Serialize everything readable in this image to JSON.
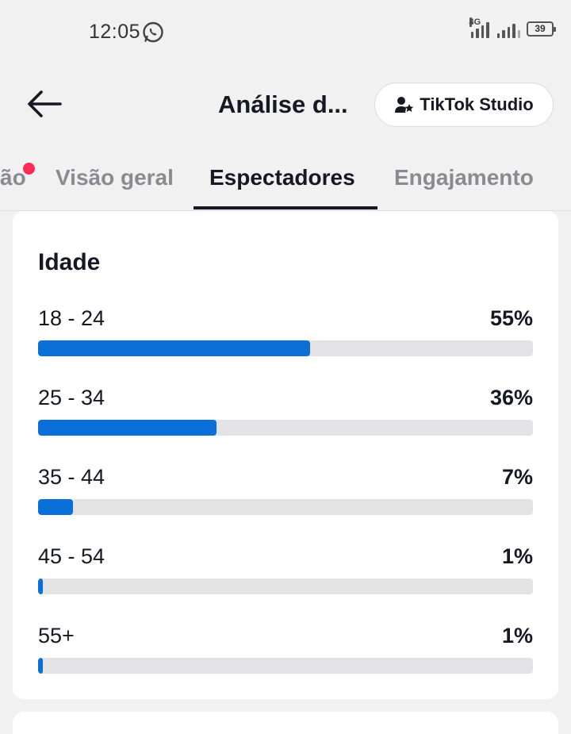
{
  "status_bar": {
    "time": "12:05",
    "network_label": "4G",
    "battery": "39",
    "icons": [
      "whatsapp-icon",
      "signal-icon",
      "battery-icon"
    ]
  },
  "header": {
    "title": "Análise d...",
    "studio_button_label": "TikTok Studio",
    "back_icon": "arrow-left-icon",
    "studio_icon": "user-star-icon"
  },
  "tabs": [
    {
      "label": "ão",
      "has_notification_dot": true,
      "active": false
    },
    {
      "label": "Visão geral",
      "active": false
    },
    {
      "label": "Espectadores",
      "active": true
    },
    {
      "label": "Engajamento",
      "active": false
    }
  ],
  "age_card": {
    "title": "Idade",
    "rows": [
      {
        "label": "18 - 24",
        "value": "55%",
        "fraction": 0.55
      },
      {
        "label": "25 - 34",
        "value": "36%",
        "fraction": 0.36
      },
      {
        "label": "35 - 44",
        "value": "7%",
        "fraction": 0.07
      },
      {
        "label": "45 - 54",
        "value": "1%",
        "fraction": 0.01
      },
      {
        "label": "55+",
        "value": "1%",
        "fraction": 0.01
      }
    ]
  },
  "colors": {
    "accent_bar": "#0a6fd8",
    "notification_dot": "#fe2c55",
    "background": "#f1f1f2",
    "track": "#e3e3e5"
  }
}
